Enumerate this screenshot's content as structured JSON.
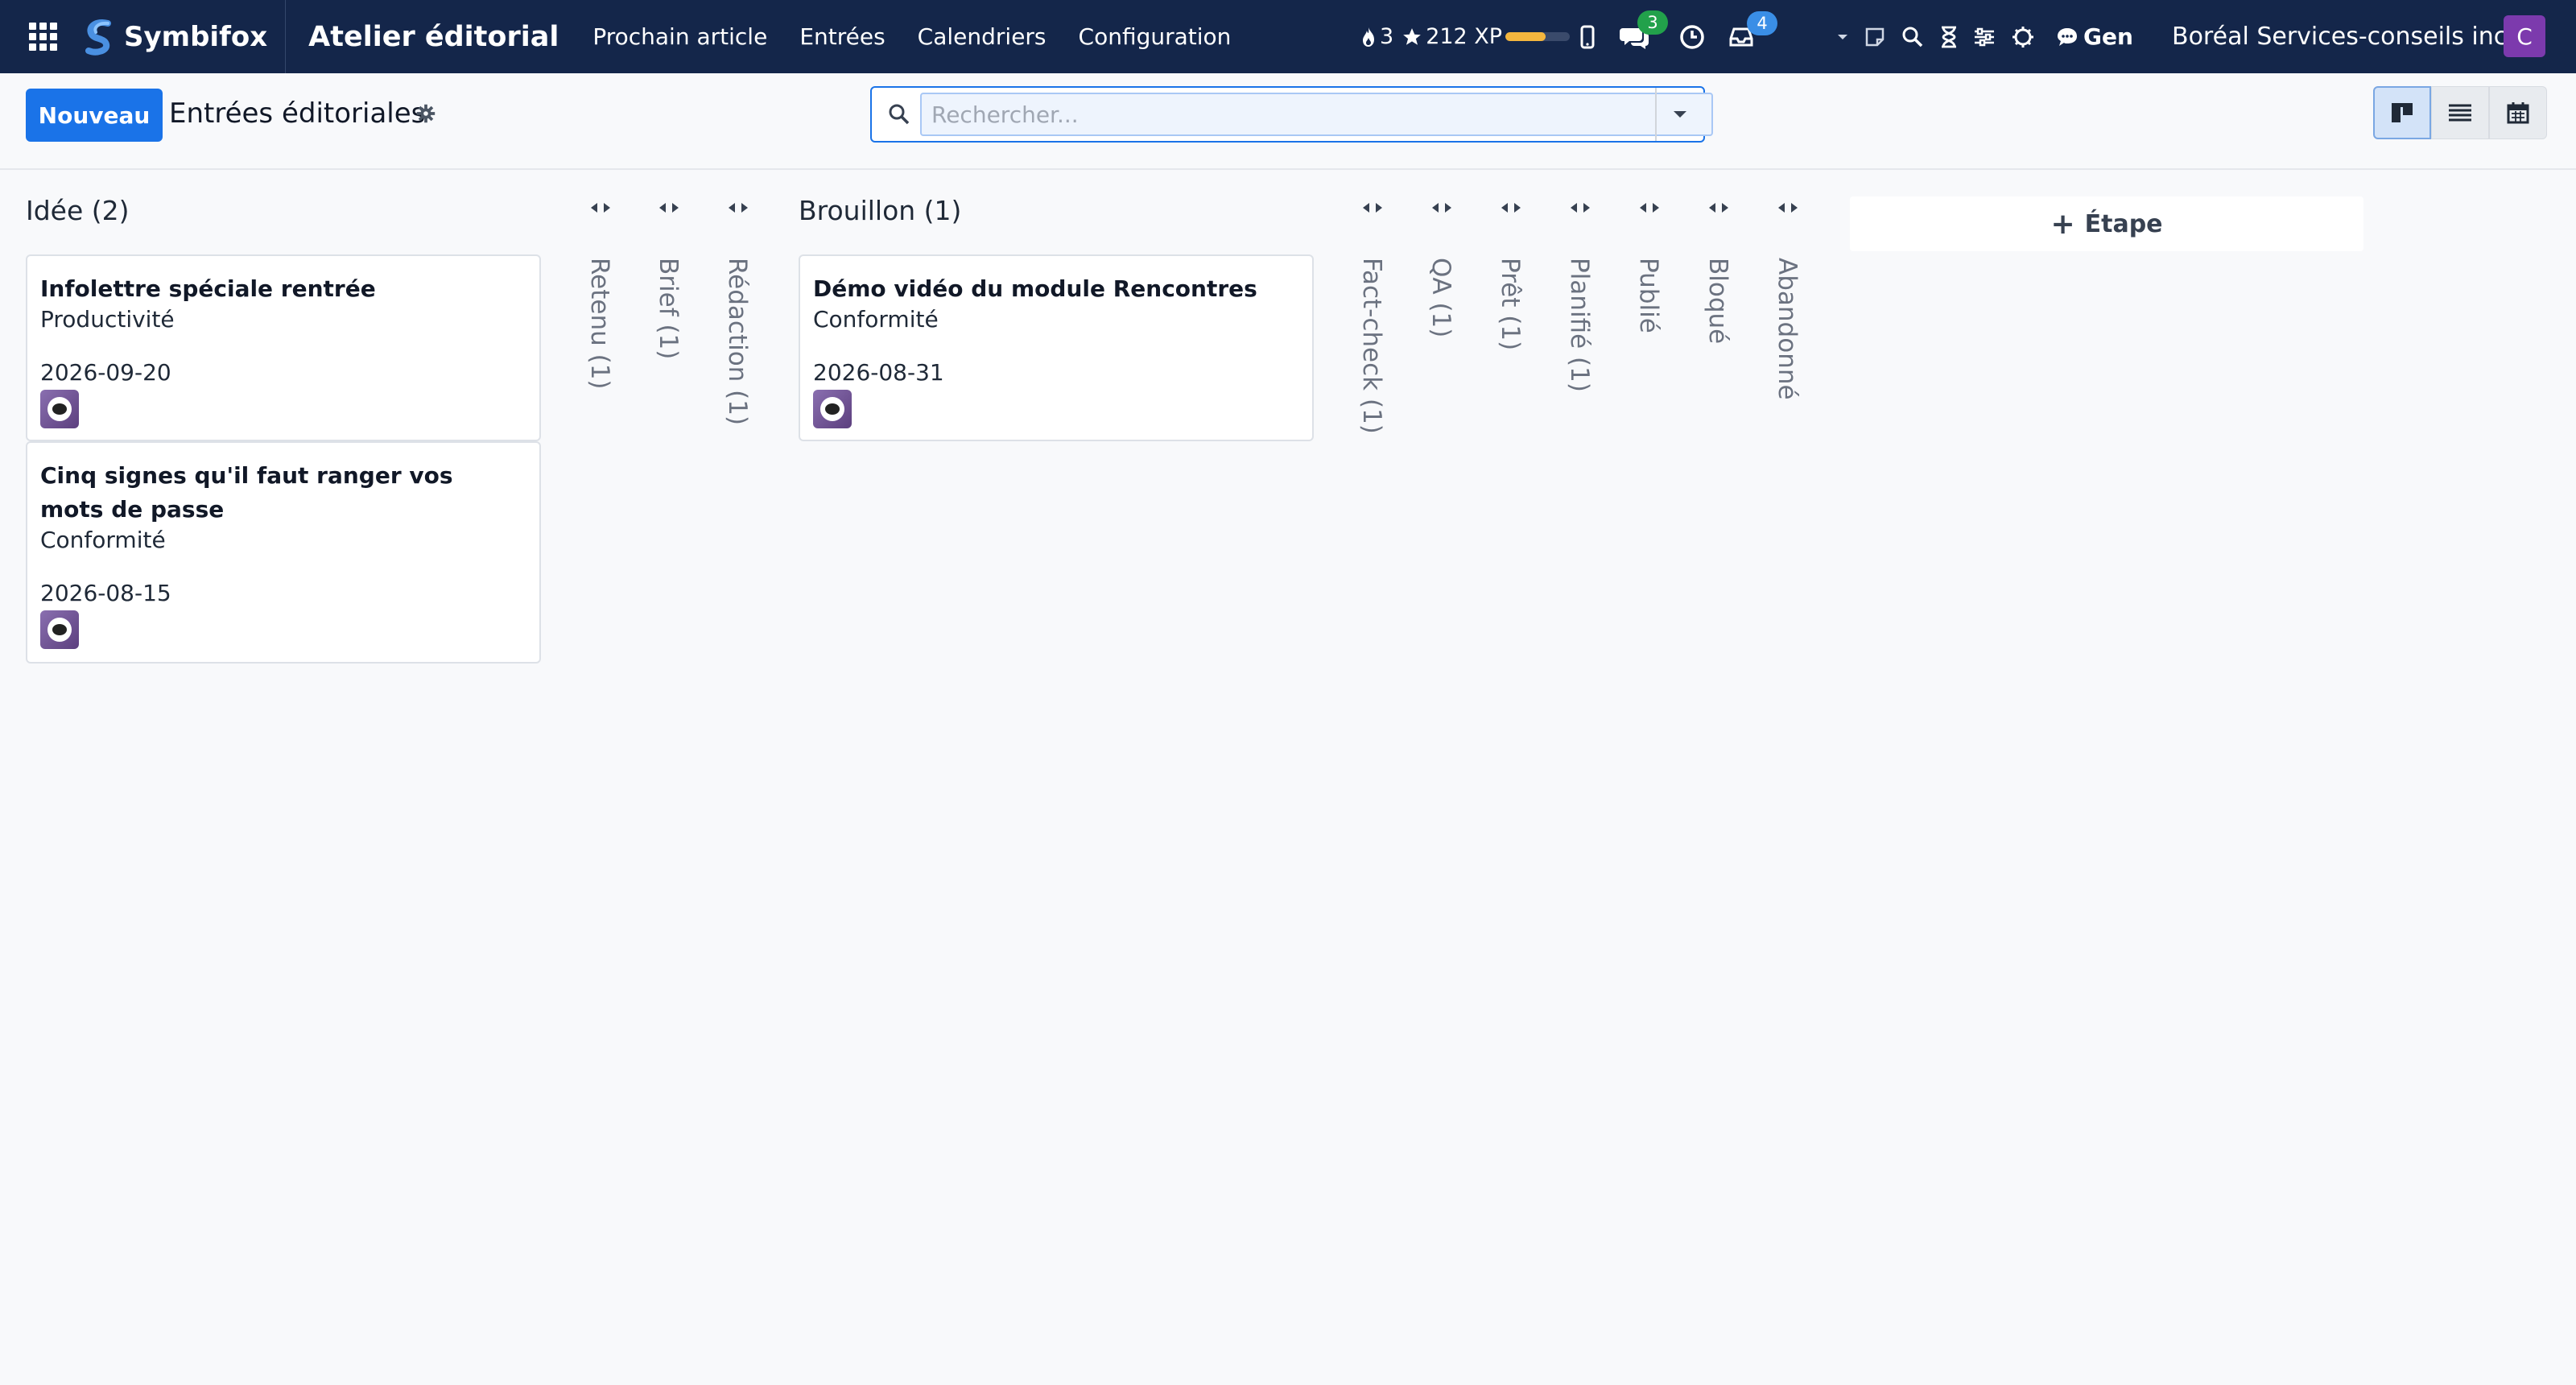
{
  "navbar": {
    "brand": "Symbifox",
    "app_title": "Atelier éditorial",
    "menu": [
      "Prochain article",
      "Entrées",
      "Calendriers",
      "Configuration"
    ],
    "gamification": {
      "streak": "3",
      "xp": "212 XP",
      "xp_progress": 0.62,
      "streak_icon": "flame-icon",
      "xp_icon": "star-icon"
    },
    "messages_badge": "3",
    "activities_badge": "4",
    "gen_label": "Gen",
    "company": "Boréal Services-conseils inc.",
    "user_initial": "C",
    "colors": {
      "navbar_bg": "#14264a",
      "badge_green": "#22a14b",
      "badge_blue": "#3a8ee6",
      "avatar": "#7c3aad"
    }
  },
  "control": {
    "new_button": "Nouveau",
    "breadcrumb": "Entrées éditoriales",
    "search_placeholder": "Rechercher...",
    "views": [
      "kanban-view-icon",
      "list-view-icon",
      "calendar-view-icon"
    ],
    "active_view": "kanban",
    "accent": "#1a73e8"
  },
  "kanban": {
    "columns": {
      "idee": {
        "title": "Idée (2)",
        "cards": [
          {
            "title": "Infolettre spéciale rentrée",
            "tag": "Productivité",
            "date": "2026-09-20"
          },
          {
            "title": "Cinq signes qu'il faut ranger vos mots de passe",
            "tag": "Conformité",
            "date": "2026-08-15"
          }
        ]
      },
      "brouillon": {
        "title": "Brouillon (1)",
        "cards": [
          {
            "title": "Démo vidéo du module Rencontres",
            "tag": "Conformité",
            "date": "2026-08-31"
          }
        ]
      }
    },
    "folded": [
      "Retenu (1)",
      "Brief (1)",
      "Rédaction (1)",
      "Fact-check (1)",
      "QA (1)",
      "Prêt (1)",
      "Planifié (1)",
      "Publié",
      "Bloqué",
      "Abandonné"
    ],
    "add_stage": "Étape"
  }
}
